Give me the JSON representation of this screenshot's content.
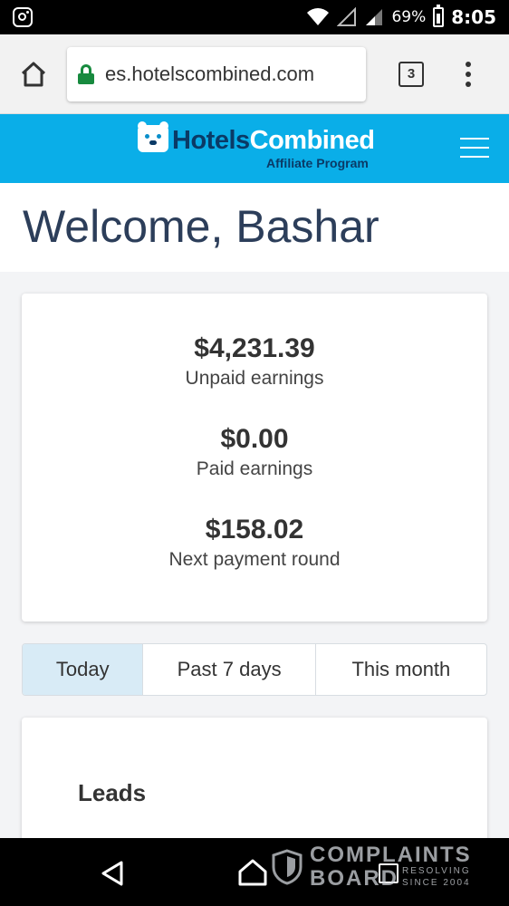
{
  "status_bar": {
    "battery_percent": "69%",
    "time": "8:05",
    "icons": [
      "instagram-icon",
      "wifi-icon",
      "signal-empty-icon",
      "signal-icon",
      "battery-charging-icon"
    ]
  },
  "browser": {
    "url": "es.hotelscombined.com",
    "tab_count": "3",
    "icons": [
      "home-icon",
      "lock-icon",
      "tabs-icon",
      "more-vert-icon"
    ]
  },
  "header": {
    "logo_brand_first": "Hotels",
    "logo_brand_second": "Combined",
    "logo_subtitle": "Affiliate Program",
    "brand_color": "#0aaee8",
    "brand_dark": "#0a3a66"
  },
  "welcome": {
    "title": "Welcome, Bashar"
  },
  "earnings": [
    {
      "amount": "$4,231.39",
      "label": "Unpaid earnings"
    },
    {
      "amount": "$0.00",
      "label": "Paid earnings"
    },
    {
      "amount": "$158.02",
      "label": "Next payment round"
    }
  ],
  "period_tabs": {
    "items": [
      {
        "label": "Today",
        "active": true
      },
      {
        "label": "Past 7 days",
        "active": false
      },
      {
        "label": "This month",
        "active": false
      }
    ],
    "active_color": "#d8ebf6"
  },
  "leads": {
    "title": "Leads"
  },
  "nav_bar": {
    "icons": [
      "back-icon",
      "home-icon",
      "recents-icon"
    ]
  },
  "watermark": {
    "line1": "COMPLAINTS",
    "line2": "BOARD",
    "tagline1": "RESOLVING",
    "tagline2": "SINCE 2004"
  }
}
